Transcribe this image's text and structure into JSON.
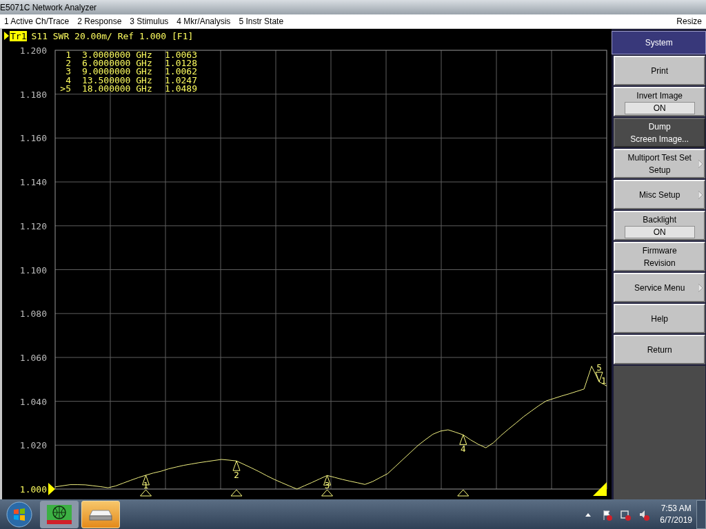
{
  "window": {
    "title": "E5071C Network Analyzer"
  },
  "menu": {
    "items": [
      {
        "label": "1 Active Ch/Trace"
      },
      {
        "label": "2 Response"
      },
      {
        "label": "3 Stimulus"
      },
      {
        "label": "4 Mkr/Analysis"
      },
      {
        "label": "5 Instr State"
      }
    ],
    "resize": "Resize"
  },
  "trace": {
    "name": "Tr1",
    "selected": true,
    "header": "S11 SWR 20.00m/ Ref 1.000 [F1]",
    "end_label": "1",
    "markers": [
      {
        "number": "1",
        "frequency": "3.0000000 GHz",
        "value": "1.0063",
        "active": false
      },
      {
        "number": "2",
        "frequency": "6.0000000 GHz",
        "value": "1.0128",
        "active": false
      },
      {
        "number": "3",
        "frequency": "9.0000000 GHz",
        "value": "1.0062",
        "active": false
      },
      {
        "number": "4",
        "frequency": "13.500000 GHz",
        "value": "1.0247",
        "active": false
      },
      {
        "number": ">5",
        "frequency": "18.000000 GHz",
        "value": "1.0489",
        "active": true
      }
    ],
    "chart_data": {
      "type": "line",
      "categories": [
        null,
        null,
        null,
        null,
        null,
        null,
        null,
        null,
        null,
        null,
        null,
        null,
        null,
        null,
        null,
        null,
        null,
        null,
        null,
        null,
        null,
        null,
        null,
        null,
        null,
        null,
        null,
        null,
        null,
        null,
        null,
        null,
        null,
        null,
        null,
        null,
        null,
        null,
        null,
        null,
        null,
        null,
        null,
        null,
        null,
        null,
        null,
        null,
        null,
        null,
        null,
        null,
        null,
        null,
        null,
        null,
        null,
        null,
        null,
        null,
        null,
        null,
        null,
        null,
        null,
        null,
        null,
        null,
        null,
        null,
        null,
        null,
        null,
        null
      ],
      "series": [
        {
          "color": "#f0f080",
          "values": [
            1.001,
            1.0015,
            1.002,
            1.002,
            1.0019,
            1.0015,
            1.0011,
            1.0006,
            1.0014,
            1.0027,
            1.004,
            1.0052,
            1.0063,
            1.0073,
            1.0081,
            1.0092,
            1.01,
            1.0108,
            1.0114,
            1.012,
            1.0125,
            1.013,
            1.0135,
            1.0132,
            1.0128,
            1.0112,
            1.0096,
            1.0079,
            1.0061,
            1.0044,
            1.0029,
            1.0014,
            1.0,
            1.0015,
            1.003,
            1.0046,
            1.0062,
            1.0053,
            1.0044,
            1.0036,
            1.0029,
            1.0021,
            1.0034,
            1.0052,
            1.007,
            1.0102,
            1.0134,
            1.0166,
            1.0198,
            1.0225,
            1.025,
            1.0264,
            1.027,
            1.0259,
            1.0247,
            1.0224,
            1.0204,
            1.0188,
            1.0211,
            1.0244,
            1.0273,
            1.0301,
            1.033,
            1.0355,
            1.038,
            1.0402,
            1.0413,
            1.0424,
            1.0434,
            1.0445,
            1.0456,
            1.056,
            1.0489,
            1.047
          ]
        }
      ],
      "ylim": [
        1.0,
        1.2
      ],
      "yticks": [
        {
          "value": 1.2,
          "label": "1.200"
        },
        {
          "value": 1.18,
          "label": "1.180"
        },
        {
          "value": 1.16,
          "label": "1.160"
        },
        {
          "value": 1.14,
          "label": "1.140"
        },
        {
          "value": 1.12,
          "label": "1.120"
        },
        {
          "value": 1.1,
          "label": "1.100"
        },
        {
          "value": 1.08,
          "label": "1.080"
        },
        {
          "value": 1.06,
          "label": "1.060"
        },
        {
          "value": 1.04,
          "label": "1.040"
        },
        {
          "value": 1.02,
          "label": "1.020"
        },
        {
          "value": 1.0,
          "label": "1.000"
        }
      ],
      "grid": true,
      "annotations": [
        "1",
        "2",
        "3",
        "4",
        "5"
      ]
    }
  },
  "softkeys": {
    "title": "System",
    "items": [
      {
        "label": "Print",
        "kind": "plain",
        "selected": false
      },
      {
        "label": "Invert Image",
        "kind": "toggle",
        "value": "ON",
        "selected": false
      },
      {
        "label": "Dump\nScreen Image...",
        "kind": "plain",
        "selected": true
      },
      {
        "label": "Multiport Test Set\nSetup",
        "kind": "submenu",
        "selected": false
      },
      {
        "label": "Misc Setup",
        "kind": "submenu",
        "selected": false
      },
      {
        "label": "Backlight",
        "kind": "toggle",
        "value": "ON",
        "selected": false
      },
      {
        "label": "Firmware\nRevision",
        "kind": "plain",
        "selected": false
      },
      {
        "label": "Service Menu",
        "kind": "submenu",
        "selected": false
      },
      {
        "label": "Help",
        "kind": "plain",
        "selected": false
      },
      {
        "label": "Return",
        "kind": "plain",
        "selected": false
      }
    ]
  },
  "taskbar": {
    "apps": [
      {
        "kind": "analyzer",
        "selected": false
      },
      {
        "kind": "drive",
        "selected": true
      }
    ],
    "time": "7:53 AM",
    "date": "6/7/2019"
  }
}
